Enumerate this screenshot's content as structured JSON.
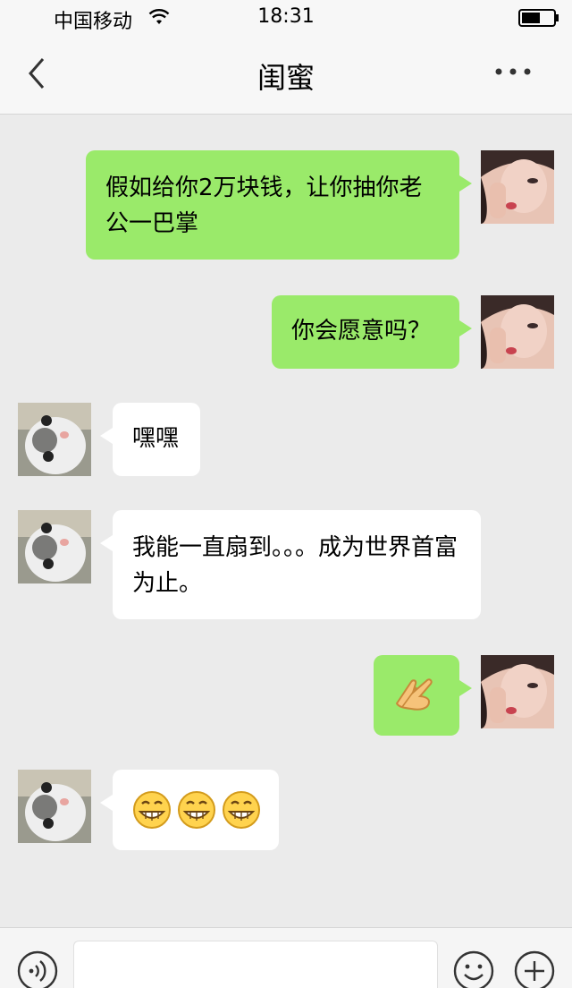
{
  "status_bar": {
    "carrier": "中国移动",
    "time": "18:31",
    "wifi_icon": "wifi-icon",
    "battery_icon": "battery-icon"
  },
  "nav": {
    "title": "闺蜜",
    "back_icon": "chevron-left-icon",
    "more_icon": "more-dots-icon"
  },
  "colors": {
    "my_bubble": "#9aea6a",
    "their_bubble": "#ffffff",
    "background": "#ebebeb"
  },
  "messages": [
    {
      "sender": "me",
      "text": "假如给你2万块钱，让你抽你老公一巴掌"
    },
    {
      "sender": "me",
      "text": "你会愿意吗？"
    },
    {
      "sender": "them",
      "text": "嘿嘿"
    },
    {
      "sender": "them",
      "text": "我能一直扇到。。。成为世界首富为止。"
    },
    {
      "sender": "me",
      "emoji": "clap-hand-emoji"
    },
    {
      "sender": "them",
      "emoji": [
        "grin-emoji",
        "grin-emoji",
        "grin-emoji"
      ]
    }
  ],
  "input_bar": {
    "voice_icon": "voice-icon",
    "input_value": "",
    "emoji_icon": "smiley-icon",
    "plus_icon": "plus-icon"
  }
}
